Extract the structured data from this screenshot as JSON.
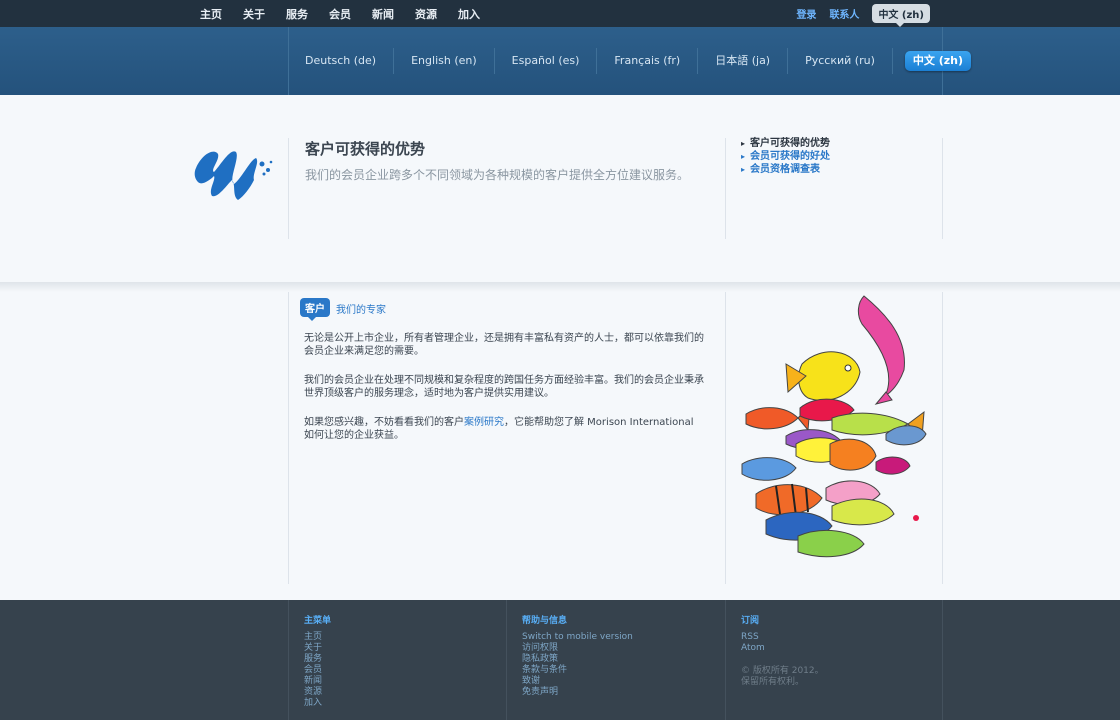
{
  "topnav": {
    "items": [
      "主页",
      "关于",
      "服务",
      "会员",
      "新闻",
      "资源",
      "加入"
    ],
    "login": "登录",
    "contact": "联系人",
    "current_lang": "中文 (zh)"
  },
  "languages": {
    "items": [
      "Deutsch (de)",
      "English (en)",
      "Español (es)",
      "Français (fr)",
      "日本語 (ja)",
      "Русский (ru)"
    ],
    "active": "中文 (zh)"
  },
  "hero": {
    "title": "客户可获得的优势",
    "description": "我们的会员企业跨多个不同领域为各种规模的客户提供全方位建议服务。",
    "side_links": {
      "current": "客户可获得的优势",
      "link1": "会员可获得的好处",
      "link2": "会员资格调查表"
    }
  },
  "main": {
    "tag": "客户",
    "tag_sub": "我们的专家",
    "para1": "无论是公开上市企业，所有者管理企业，还是拥有丰富私有资产的人士，都可以依靠我们的会员企业来满足您的需要。",
    "para2": "我们的会员企业在处理不同规模和复杂程度的跨国任务方面经验丰富。我们的会员企业秉承世界顶级客户的服务理念，适时地为客户提供实用建议。",
    "para3_before": "如果您感兴趣，不妨看看我们的客户",
    "para3_link": "案例研究",
    "para3_after": "，它能帮助您了解 Morison International 如何让您的企业获益。"
  },
  "footer": {
    "col1": {
      "title": "主菜单",
      "links": [
        "主页",
        "关于",
        "服务",
        "会员",
        "新闻",
        "资源",
        "加入"
      ]
    },
    "col2": {
      "title": "帮助与信息",
      "links": [
        "Switch to mobile version",
        "访问权限",
        "隐私政策",
        "条款与条件",
        "致谢",
        "免责声明"
      ]
    },
    "col3": {
      "title": "订阅",
      "links": [
        "RSS",
        "Atom"
      ],
      "copyright1": "© 版权所有 2012。",
      "copyright2": "保留所有权利。"
    }
  },
  "colors": {
    "topbar": "#22313f",
    "langbar": "#2d5f8b",
    "accent": "#2a78c8",
    "footer": "#36424d"
  }
}
